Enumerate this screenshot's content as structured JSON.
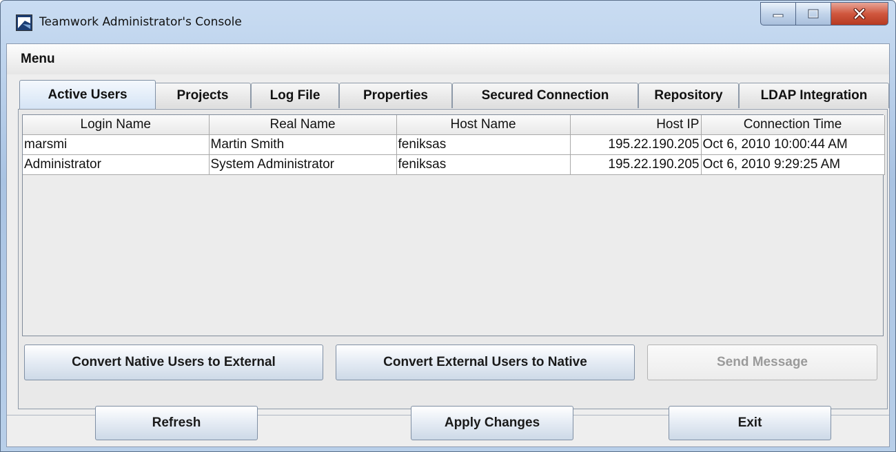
{
  "window": {
    "title": "Teamwork Administrator's Console",
    "controls": {
      "minimize": "minimize-icon",
      "maximize": "maximize-icon",
      "close": "close-icon"
    },
    "colors": {
      "title_bar": "#b8cfe9",
      "close_button": "#d0573e"
    }
  },
  "menu": {
    "label": "Menu"
  },
  "tabs": [
    {
      "label": "Active Users",
      "active": true
    },
    {
      "label": "Projects"
    },
    {
      "label": "Log File"
    },
    {
      "label": "Properties"
    },
    {
      "label": "Secured Connection"
    },
    {
      "label": "Repository"
    },
    {
      "label": "LDAP Integration"
    }
  ],
  "table": {
    "columns": [
      "Login Name",
      "Real Name",
      "Host Name",
      "Host IP",
      "Connection Time"
    ],
    "rows": [
      [
        "marsmi",
        "Martin Smith",
        "feniksas",
        "195.22.190.205",
        "Oct 6, 2010 10:00:44 AM"
      ],
      [
        "Administrator",
        "System Administrator",
        "feniksas",
        "195.22.190.205",
        "Oct 6, 2010 9:29:25 AM"
      ]
    ]
  },
  "actions": {
    "convert_to_external": "Convert Native Users to External",
    "convert_to_native": "Convert External Users to Native",
    "send_message": "Send Message"
  },
  "footer": {
    "refresh": "Refresh",
    "apply": "Apply Changes",
    "exit": "Exit"
  }
}
